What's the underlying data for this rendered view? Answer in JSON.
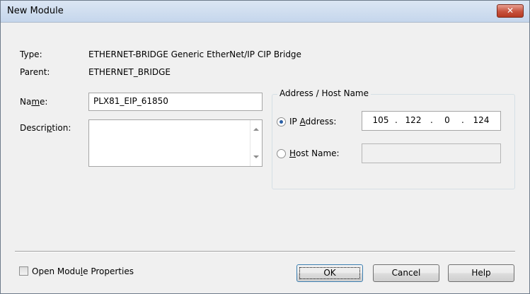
{
  "window": {
    "title": "New Module",
    "close_glyph": "✕"
  },
  "fields": {
    "type_label": "Type:",
    "type_value": "ETHERNET-BRIDGE Generic EtherNet/IP CIP Bridge",
    "parent_label": "Parent:",
    "parent_value": "ETHERNET_BRIDGE",
    "name_label_pre": "Na",
    "name_label_mnemonic": "m",
    "name_label_post": "e:",
    "name_value": "PLX81_EIP_61850",
    "description_label_pre": "Descri",
    "description_label_mnemonic": "p",
    "description_label_post": "tion:",
    "description_value": ""
  },
  "address": {
    "group_title": "Address / Host Name",
    "ip_label_pre": "IP ",
    "ip_label_mnemonic": "A",
    "ip_label_post": "ddress:",
    "ip_octets": [
      "105",
      "122",
      "0",
      "124"
    ],
    "ip_selected": true,
    "host_label_mnemonic": "H",
    "host_label_post": "ost Name:",
    "host_value": "",
    "host_selected": false
  },
  "footer": {
    "open_props_pre": "Open Modu",
    "open_props_mnemonic": "l",
    "open_props_post": "e Properties",
    "open_props_checked": false,
    "ok_label": "OK",
    "cancel_label": "Cancel",
    "help_label": "Help"
  }
}
